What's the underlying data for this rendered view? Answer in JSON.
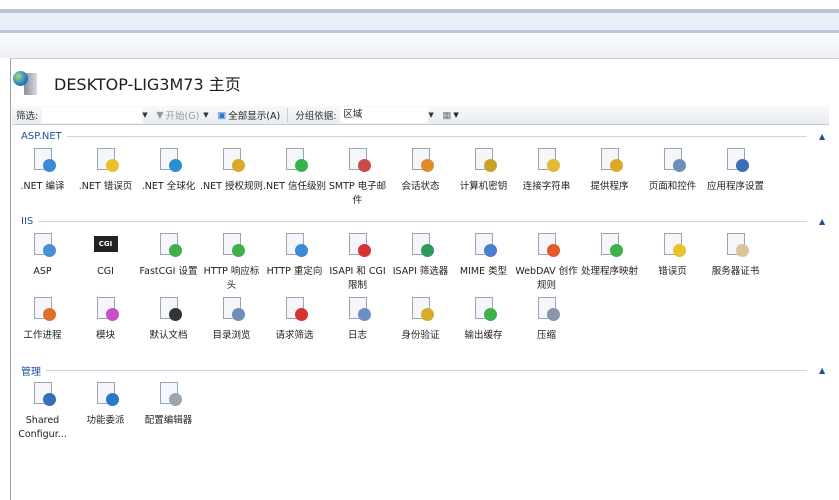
{
  "title": "DESKTOP-LIG3M73 主页",
  "toolbar": {
    "filter_label": "筛选:",
    "filter_value": "",
    "start_label": "开始(G)",
    "show_all_label": "全部显示(A)",
    "group_by_label": "分组依据:",
    "group_by_value": "区域"
  },
  "sections": [
    {
      "title": "ASP.NET",
      "rows": [
        [
          {
            "label": ".NET 编译",
            "icon": "net-compile-icon",
            "color": "#3a8ad6"
          },
          {
            "label": ".NET 错误页",
            "icon": "error-page-404-icon",
            "color": "#e8c22a"
          },
          {
            "label": ".NET 全球化",
            "icon": "globe-icon",
            "color": "#2a8fd0"
          },
          {
            "label": ".NET 授权规则",
            "icon": "lock-document-icon",
            "color": "#d9a92a"
          },
          {
            "label": ".NET 信任级别",
            "icon": "trust-check-icon",
            "color": "#37b24d"
          },
          {
            "label": "SMTP 电子邮件",
            "icon": "email-icon",
            "color": "#c94a4a"
          },
          {
            "label": "会话状态",
            "icon": "session-user-icon",
            "color": "#e08a2c"
          },
          {
            "label": "计算机密钥",
            "icon": "machine-key-icon",
            "color": "#c9a227"
          },
          {
            "label": "连接字符串",
            "icon": "database-ab-icon",
            "color": "#e6b83a"
          },
          {
            "label": "提供程序",
            "icon": "provider-user-icon",
            "color": "#d9a92a"
          },
          {
            "label": "页面和控件",
            "icon": "pages-controls-icon",
            "color": "#6d8fb8"
          },
          {
            "label": "应用程序设置",
            "icon": "app-settings-checklist-icon",
            "color": "#3a6fb8"
          }
        ]
      ]
    },
    {
      "title": "IIS",
      "rows": [
        [
          {
            "label": "ASP",
            "icon": "asp-gear-icon",
            "color": "#4a8fd6"
          },
          {
            "label": "CGI",
            "icon": "cgi-icon",
            "color": "#222222",
            "text": "CGI"
          },
          {
            "label": "FastCGI 设置",
            "icon": "fastcgi-arrow-icon",
            "color": "#3fb04a"
          },
          {
            "label": "HTTP 响应标头",
            "icon": "http-headers-arrow-icon",
            "color": "#3fb04a"
          },
          {
            "label": "HTTP 重定向",
            "icon": "http-redirect-icon",
            "color": "#3a8ad6"
          },
          {
            "label": "ISAPI 和 CGI 限制",
            "icon": "isapi-cgi-restrict-icon",
            "color": "#d83232"
          },
          {
            "label": "ISAPI 筛选器",
            "icon": "isapi-filter-globe-icon",
            "color": "#2f9a5a"
          },
          {
            "label": "MIME 类型",
            "icon": "mime-music-icon",
            "color": "#4a7fd0"
          },
          {
            "label": "WebDAV 创作规则",
            "icon": "webdav-globe-icon",
            "color": "#e05a2a"
          },
          {
            "label": "处理程序映射",
            "icon": "handler-arrows-icon",
            "color": "#3fb04a"
          },
          {
            "label": "错误页",
            "icon": "error-page-404-icon",
            "color": "#e8c22a"
          },
          {
            "label": "服务器证书",
            "icon": "certificate-icon",
            "color": "#d9c59a"
          }
        ],
        [
          {
            "label": "工作进程",
            "icon": "worker-process-icon",
            "color": "#e0702a"
          },
          {
            "label": "模块",
            "icon": "modules-icon",
            "color": "#c84fc8"
          },
          {
            "label": "默认文档",
            "icon": "default-document-icon",
            "color": "#333333"
          },
          {
            "label": "目录浏览",
            "icon": "directory-browse-icon",
            "color": "#6d8fb8"
          },
          {
            "label": "请求筛选",
            "icon": "request-filter-icon",
            "color": "#d83232"
          },
          {
            "label": "日志",
            "icon": "log-book-icon",
            "color": "#6d8fc8"
          },
          {
            "label": "身份验证",
            "icon": "authentication-user-icon",
            "color": "#d9a92a"
          },
          {
            "label": "输出缓存",
            "icon": "output-cache-icon",
            "color": "#3fb04a"
          },
          {
            "label": "压缩",
            "icon": "compression-clamp-icon",
            "color": "#8a96a8"
          }
        ]
      ]
    },
    {
      "title": "管理",
      "rows": [
        [
          {
            "label": "Shared Configur...",
            "icon": "shared-config-checklist-icon",
            "color": "#3a6fb8"
          },
          {
            "label": "功能委派",
            "icon": "feature-delegation-icon",
            "color": "#2a79c9"
          },
          {
            "label": "配置编辑器",
            "icon": "config-editor-icon",
            "color": "#9aa5b3"
          }
        ]
      ]
    }
  ]
}
